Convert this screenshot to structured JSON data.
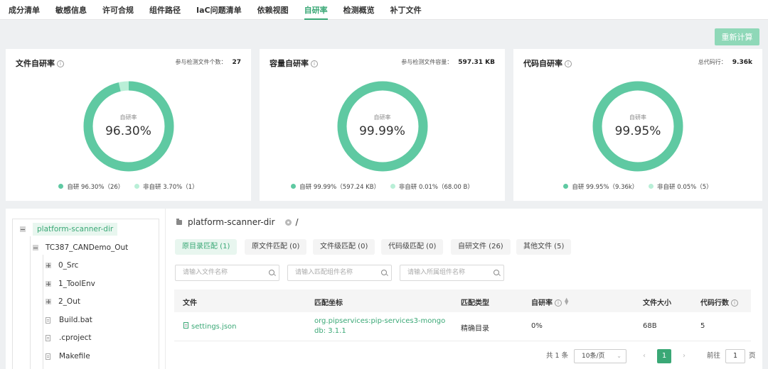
{
  "nav": {
    "items": [
      "成分清单",
      "敏感信息",
      "许可合规",
      "组件路径",
      "IaC问题清单",
      "依赖视图",
      "自研率",
      "检测概览",
      "补丁文件"
    ],
    "active": "自研率"
  },
  "recalc_label": "重新计算",
  "cards": [
    {
      "title": "文件自研率",
      "meta_label": "参与检测文件个数：",
      "meta_value": "27",
      "center_label": "自研率",
      "center_value": "96.30%",
      "self_pct": 96.3,
      "legend_self": "自研 96.30%（26）",
      "legend_other": "非自研 3.70%（1）"
    },
    {
      "title": "容量自研率",
      "meta_label": "参与检测文件容量：",
      "meta_value": "597.31 KB",
      "center_label": "自研率",
      "center_value": "99.99%",
      "self_pct": 99.99,
      "legend_self": "自研 99.99%（597.24 KB）",
      "legend_other": "非自研 0.01%（68.00 B）"
    },
    {
      "title": "代码自研率",
      "meta_label": "总代码行：",
      "meta_value": "9.36k",
      "center_label": "自研率",
      "center_value": "99.95%",
      "self_pct": 99.95,
      "legend_self": "自研 99.95%（9.36k）",
      "legend_other": "非自研 0.05%（5）"
    }
  ],
  "colors": {
    "self": "#5fc9a2",
    "other": "#b9efd7",
    "accent": "#3aa876"
  },
  "tree": {
    "root": "platform-scanner-dir",
    "child": "TC387_CANDemo_Out",
    "folders": [
      "0_Src",
      "1_ToolEnv",
      "2_Out"
    ],
    "files": [
      "Build.bat",
      ".cproject",
      "Makefile"
    ]
  },
  "path": {
    "dir": "platform-scanner-dir",
    "sep": "/"
  },
  "tabs": [
    "原目录匹配 (1)",
    "原文件匹配 (0)",
    "文件级匹配 (0)",
    "代码级匹配 (0)",
    "自研文件 (26)",
    "其他文件 (5)"
  ],
  "search": {
    "file_placeholder": "请输入文件名称",
    "coord_placeholder": "请输入匹配组件名称",
    "comp_placeholder": "请输入所属组件名称"
  },
  "table": {
    "headers": {
      "file": "文件",
      "coord": "匹配坐标",
      "type": "匹配类型",
      "rate": "自研率",
      "size": "文件大小",
      "lines": "代码行数"
    },
    "rows": [
      {
        "file": "settings.json",
        "coord_line1": "org.pipservices:pip-services3-mongo",
        "coord_line2": "db: 3.1.1",
        "type": "精确目录",
        "rate": "0%",
        "size": "68B",
        "lines": "5"
      }
    ]
  },
  "pagination": {
    "total": "共 1 条",
    "page_size": "10条/页",
    "prev": "‹",
    "current": "1",
    "next": "›",
    "goto_label": "前往",
    "goto_value": "1",
    "page_suffix": "页"
  }
}
